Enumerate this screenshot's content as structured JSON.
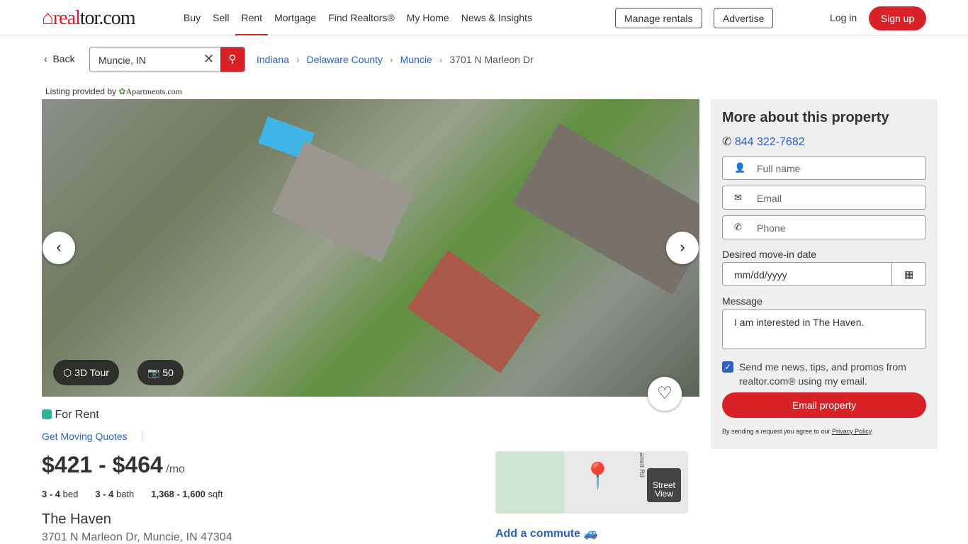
{
  "header": {
    "logo": "realtor.com",
    "nav": [
      "Buy",
      "Sell",
      "Rent",
      "Mortgage",
      "Find Realtors®",
      "My Home",
      "News & Insights"
    ],
    "active_nav": "Rent",
    "manage_rentals": "Manage rentals",
    "advertise": "Advertise",
    "login": "Log in",
    "signup": "Sign up",
    "accent": "#d92228"
  },
  "search": {
    "back": "Back",
    "value": "Muncie, IN"
  },
  "breadcrumb": [
    "Indiana",
    "Delaware County",
    "Muncie",
    "3701 N Marleon Dr"
  ],
  "listing_provider": {
    "prefix": "Listing provided by",
    "name": "Apartments.com"
  },
  "gallery": {
    "tour": "3D Tour",
    "photo_count": "50"
  },
  "listing": {
    "status": "For Rent",
    "status_color": "#2bb596",
    "moving_quotes": "Get Moving Quotes",
    "price": "$421 - $464",
    "price_unit": "/mo",
    "beds": "3 - 4",
    "beds_label": "bed",
    "baths": "3 - 4",
    "baths_label": "bath",
    "sqft": "1,368 - 1,600",
    "sqft_label": "sqft",
    "name": "The Haven",
    "address": "3701 N Marleon Dr, Muncie, IN 47304"
  },
  "map": {
    "road_label": "arrett Rd",
    "street_view": "Street View",
    "commute": "Add a commute"
  },
  "form": {
    "title": "More about this property",
    "phone": "844 322-7682",
    "full_name": "Full name",
    "email": "Email",
    "phone_ph": "Phone",
    "move_in_label": "Desired move-in date",
    "move_in_ph": "mm/dd/yyyy",
    "message_label": "Message",
    "message": "I am interested in The Haven.",
    "opt_in": "Send me news, tips, and promos from realtor.com® using my email.",
    "opt_in_checked": true,
    "submit": "Email property",
    "disclaimer": "By sending a request you agree to our",
    "privacy": "Privacy Policy"
  }
}
